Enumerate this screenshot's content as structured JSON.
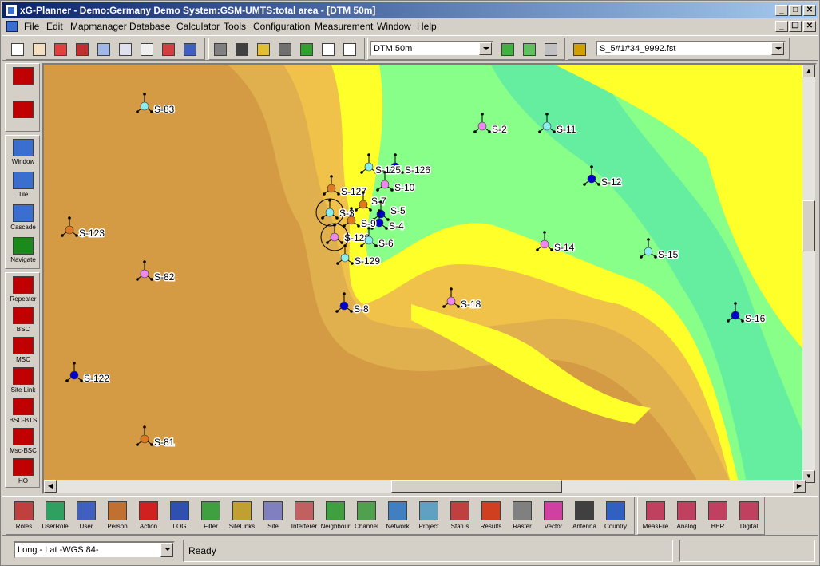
{
  "window": {
    "title": "xG-Planner - Demo:Germany Demo System:GSM-UMTS:total area - [DTM 50m]",
    "minimize_glyph": "_",
    "maximize_glyph": "□",
    "close_glyph": "✕",
    "mdi_minimize_glyph": "_",
    "mdi_restore_glyph": "❐",
    "mdi_close_glyph": "✕"
  },
  "menu": [
    "File",
    "Edit",
    "Mapmanager",
    "Database",
    "Calculator",
    "Tools",
    "Configuration",
    "Measurement",
    "Window",
    "Help"
  ],
  "toolbar": {
    "map_layer_value": "DTM 50m",
    "file_value": "S_5#1#34_9992.fst",
    "tool_icons": [
      "select-arrow",
      "pan-hand",
      "site-tool",
      "calculator",
      "zoom-out-box",
      "zoom-in",
      "scale",
      "measure",
      "route"
    ],
    "second_icons": [
      "grid-table",
      "los-calc",
      "transmitter",
      "database-cylinder",
      "report",
      "help-cursor",
      "window-icon"
    ],
    "map_icons": [
      "network-green",
      "rays",
      "mast"
    ],
    "file_icon": "coverage-file"
  },
  "left_toolbar": {
    "top": [
      {
        "label": "",
        "icon": "los-icon",
        "color": "#c00000"
      },
      {
        "label": "",
        "icon": "db-profile-icon",
        "color": "#c00000"
      }
    ],
    "window": [
      {
        "label": "Window",
        "icon": "window-icon",
        "color": "#3a6fd0"
      },
      {
        "label": "Tile",
        "icon": "tile-icon",
        "color": "#3a6fd0"
      },
      {
        "label": "Cascade",
        "icon": "cascade-icon",
        "color": "#3a6fd0"
      },
      {
        "label": "Navigate",
        "icon": "navigate-icon",
        "color": "#1a8a1a"
      }
    ],
    "network": [
      {
        "label": "Repeater",
        "icon": "repeater-icon",
        "color": "#c00000"
      },
      {
        "label": "BSC",
        "icon": "bsc-icon",
        "color": "#c00000"
      },
      {
        "label": "MSC",
        "icon": "msc-icon",
        "color": "#c00000"
      },
      {
        "label": "Site Link",
        "icon": "site-link-icon",
        "color": "#c00000"
      },
      {
        "label": "BSC-BTS",
        "icon": "bsc-bts-icon",
        "color": "#c00000"
      },
      {
        "label": "Msc-BSC",
        "icon": "msc-bsc-icon",
        "color": "#c00000"
      },
      {
        "label": "HO",
        "icon": "handover-icon",
        "color": "#c00000"
      }
    ]
  },
  "bottom_toolbar": {
    "main": [
      {
        "label": "Roles",
        "icon": "roles-icon"
      },
      {
        "label": "UserRole",
        "icon": "user-role-icon"
      },
      {
        "label": "User",
        "icon": "user-icon"
      },
      {
        "label": "Person",
        "icon": "person-icon"
      },
      {
        "label": "Action",
        "icon": "action-icon"
      },
      {
        "label": "LOG",
        "icon": "log-icon"
      },
      {
        "label": "Filter",
        "icon": "filter-icon"
      },
      {
        "label": "SiteLinks",
        "icon": "site-links-icon"
      },
      {
        "label": "Site",
        "icon": "site-icon"
      },
      {
        "label": "Interferer",
        "icon": "interferer-icon"
      },
      {
        "label": "Neighbour",
        "icon": "neighbour-icon"
      },
      {
        "label": "Channel",
        "icon": "channel-icon"
      },
      {
        "label": "Network",
        "icon": "network-icon"
      },
      {
        "label": "Project",
        "icon": "project-icon"
      },
      {
        "label": "Status",
        "icon": "status-icon"
      },
      {
        "label": "Results",
        "icon": "results-icon"
      },
      {
        "label": "Raster",
        "icon": "raster-icon"
      },
      {
        "label": "Vector",
        "icon": "vector-icon"
      },
      {
        "label": "Antenna",
        "icon": "antenna-icon"
      },
      {
        "label": "Country",
        "icon": "country-icon"
      }
    ],
    "measure": [
      {
        "label": "MeasFile",
        "icon": "meas-file-icon"
      },
      {
        "label": "Analog",
        "icon": "analog-icon"
      },
      {
        "label": "BER",
        "icon": "ber-icon"
      },
      {
        "label": "Digital",
        "icon": "digital-icon"
      }
    ]
  },
  "status": {
    "projection_value": "Long - Lat -WGS 84-",
    "message": "Ready",
    "panel3": "",
    "panel4": ""
  },
  "map": {
    "colors": {
      "deep": "#d49a44",
      "mid": "#e0b04e",
      "upper": "#f0c24a",
      "yellow": "#ffff2a",
      "green": "#88ff88",
      "aqua": "#66eea0"
    },
    "sites": [
      {
        "label": "S-83",
        "color": "#88eeee"
      },
      {
        "label": "S-2",
        "color": "#ee88ee"
      },
      {
        "label": "S-11",
        "color": "#88eeee"
      },
      {
        "label": "S-126",
        "color": "#0000cc"
      },
      {
        "label": "S-12",
        "color": "#0000cc"
      },
      {
        "label": "S-125",
        "color": "#88eeee"
      },
      {
        "label": "S-10",
        "color": "#ee88ee"
      },
      {
        "label": "S-127",
        "color": "#e07820"
      },
      {
        "label": "S-7",
        "color": "#e07820"
      },
      {
        "label": "S-5",
        "color": "#0000cc"
      },
      {
        "label": "S-4",
        "color": "#0000cc"
      },
      {
        "label": "S-3",
        "color": "#88eeee"
      },
      {
        "label": "S-9",
        "color": "#e07820"
      },
      {
        "label": "S-123",
        "color": "#e07820"
      },
      {
        "label": "S-128",
        "color": "#ee88ee"
      },
      {
        "label": "S-6",
        "color": "#88eeee"
      },
      {
        "label": "S-14",
        "color": "#ee88ee"
      },
      {
        "label": "S-15",
        "color": "#88eeee"
      },
      {
        "label": "S-129",
        "color": "#88eeee"
      },
      {
        "label": "S-82",
        "color": "#ee88ee"
      },
      {
        "label": "S-18",
        "color": "#ee88ee"
      },
      {
        "label": "S-8",
        "color": "#0000cc"
      },
      {
        "label": "S-16",
        "color": "#0000cc"
      },
      {
        "label": "S-122",
        "color": "#0000cc"
      },
      {
        "label": "S-81",
        "color": "#e07820"
      }
    ]
  }
}
